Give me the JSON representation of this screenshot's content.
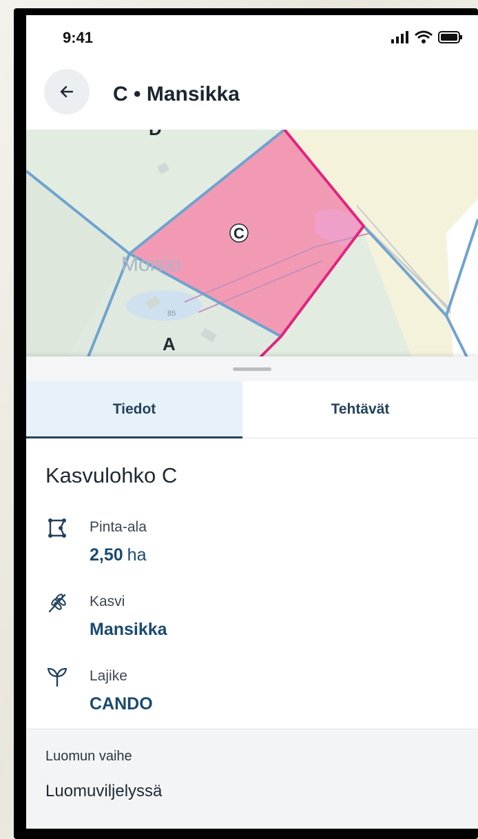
{
  "status_bar": {
    "time": "9:41",
    "icons": [
      "signal-icon",
      "wifi-icon",
      "battery-icon"
    ]
  },
  "header": {
    "title": "C • Mansikka",
    "back_icon": "arrow-left-icon"
  },
  "map": {
    "place_name": "Moisio",
    "address_number": "85",
    "parcel_labels": {
      "selected": "C",
      "left": "A",
      "top": "D"
    },
    "colors": {
      "selected_fill": "#f29ab4",
      "selected_border": "#e0257f",
      "parcel_border": "#6fa3cf",
      "field": "#dfe9df",
      "open_area": "#f5f2dc"
    }
  },
  "tabs": [
    {
      "label": "Tiedot",
      "active": true
    },
    {
      "label": "Tehtävät",
      "active": false
    }
  ],
  "details": {
    "title": "Kasvulohko C",
    "area": {
      "label": "Pinta-ala",
      "value": "2,50",
      "unit": "ha",
      "icon": "area-polygon-icon"
    },
    "crop": {
      "label": "Kasvi",
      "value": "Mansikka",
      "icon": "wheat-icon"
    },
    "variety": {
      "label": "Lajike",
      "value": "CANDO",
      "icon": "sprout-icon"
    }
  },
  "organic": {
    "label": "Luomun vaihe",
    "value": "Luomuviljelyssä"
  },
  "colors": {
    "accent": "#1a4a70",
    "tab_active_bg": "#e6f1f8"
  }
}
